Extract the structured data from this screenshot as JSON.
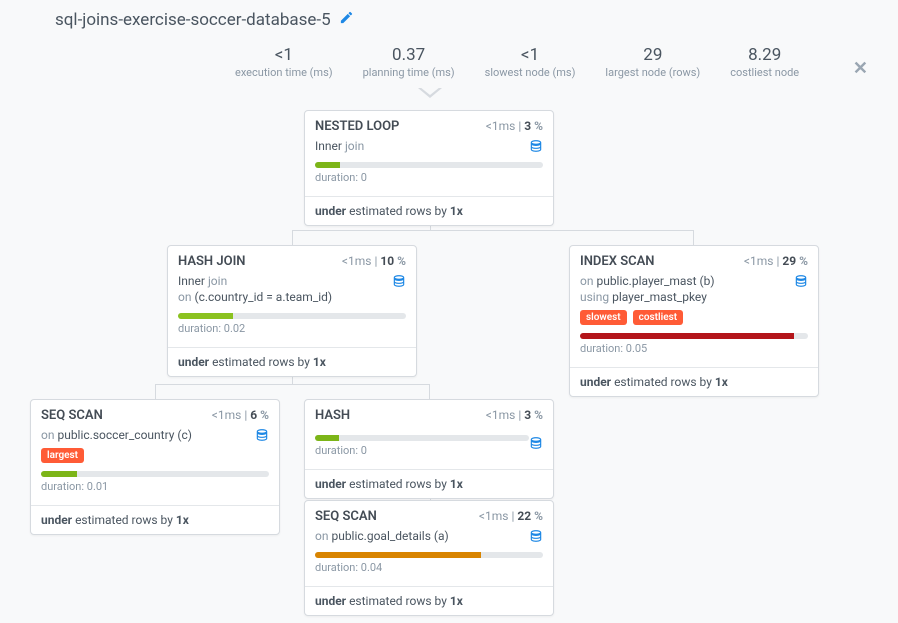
{
  "title": "sql-joins-exercise-soccer-database-5",
  "stats": {
    "exec": {
      "val": "<1",
      "label": "execution time (ms)"
    },
    "plan": {
      "val": "0.37",
      "label": "planning time (ms)"
    },
    "slow": {
      "val": "<1",
      "label": "slowest node (ms)"
    },
    "large": {
      "val": "29",
      "label": "largest node (rows)"
    },
    "costly": {
      "val": "8.29",
      "label": "costliest node"
    }
  },
  "nodes": {
    "nestedloop": {
      "title": "NESTED LOOP",
      "time": "<1",
      "unit": "ms",
      "pct": "3",
      "join_word": "Inner",
      "join_rest": "join",
      "bar_pct": 11,
      "bar_color": "#7cb518",
      "dur_label": "duration:",
      "dur_val": "0",
      "est_pre": "under",
      "est_mid": "estimated rows by",
      "est_mult": "1x"
    },
    "hashjoin": {
      "title": "HASH JOIN",
      "time": "<1",
      "unit": "ms",
      "pct": "10",
      "join_word": "Inner",
      "join_rest": "join",
      "on_pre": "on",
      "on_cond": "(c.country_id = a.team_id)",
      "bar_pct": 24,
      "bar_color": "#8bc220",
      "dur_label": "duration:",
      "dur_val": "0.02",
      "est_pre": "under",
      "est_mid": "estimated rows by",
      "est_mult": "1x"
    },
    "indexscan": {
      "title": "INDEX SCAN",
      "time": "<1",
      "unit": "ms",
      "pct": "29",
      "on_pre": "on",
      "on_tbl": "public.player_mast (b)",
      "using_pre": "using",
      "using_idx": "player_mast_pkey",
      "tag1": "slowest",
      "tag2": "costliest",
      "bar_pct": 94,
      "bar_color": "#b3151a",
      "dur_label": "duration:",
      "dur_val": "0.05",
      "est_pre": "under",
      "est_mid": "estimated rows by",
      "est_mult": "1x"
    },
    "seqcountry": {
      "title": "SEQ SCAN",
      "time": "<1",
      "unit": "ms",
      "pct": "6",
      "on_pre": "on",
      "on_tbl": "public.soccer_country (c)",
      "tag": "largest",
      "bar_pct": 16,
      "bar_color": "#7cb518",
      "dur_label": "duration:",
      "dur_val": "0.01",
      "est_pre": "under",
      "est_mid": "estimated rows by",
      "est_mult": "1x"
    },
    "hash": {
      "title": "HASH",
      "time": "<1",
      "unit": "ms",
      "pct": "3",
      "bar_pct": 11,
      "bar_color": "#7cb518",
      "dur_label": "duration:",
      "dur_val": "0",
      "est_pre": "under",
      "est_mid": "estimated rows by",
      "est_mult": "1x"
    },
    "seqgoal": {
      "title": "SEQ SCAN",
      "time": "<1",
      "unit": "ms",
      "pct": "22",
      "on_pre": "on",
      "on_tbl": "public.goal_details (a)",
      "bar_pct": 73,
      "bar_color": "#d88400",
      "dur_label": "duration:",
      "dur_val": "0.04",
      "est_pre": "under",
      "est_mid": "estimated rows by",
      "est_mult": "1x"
    }
  }
}
